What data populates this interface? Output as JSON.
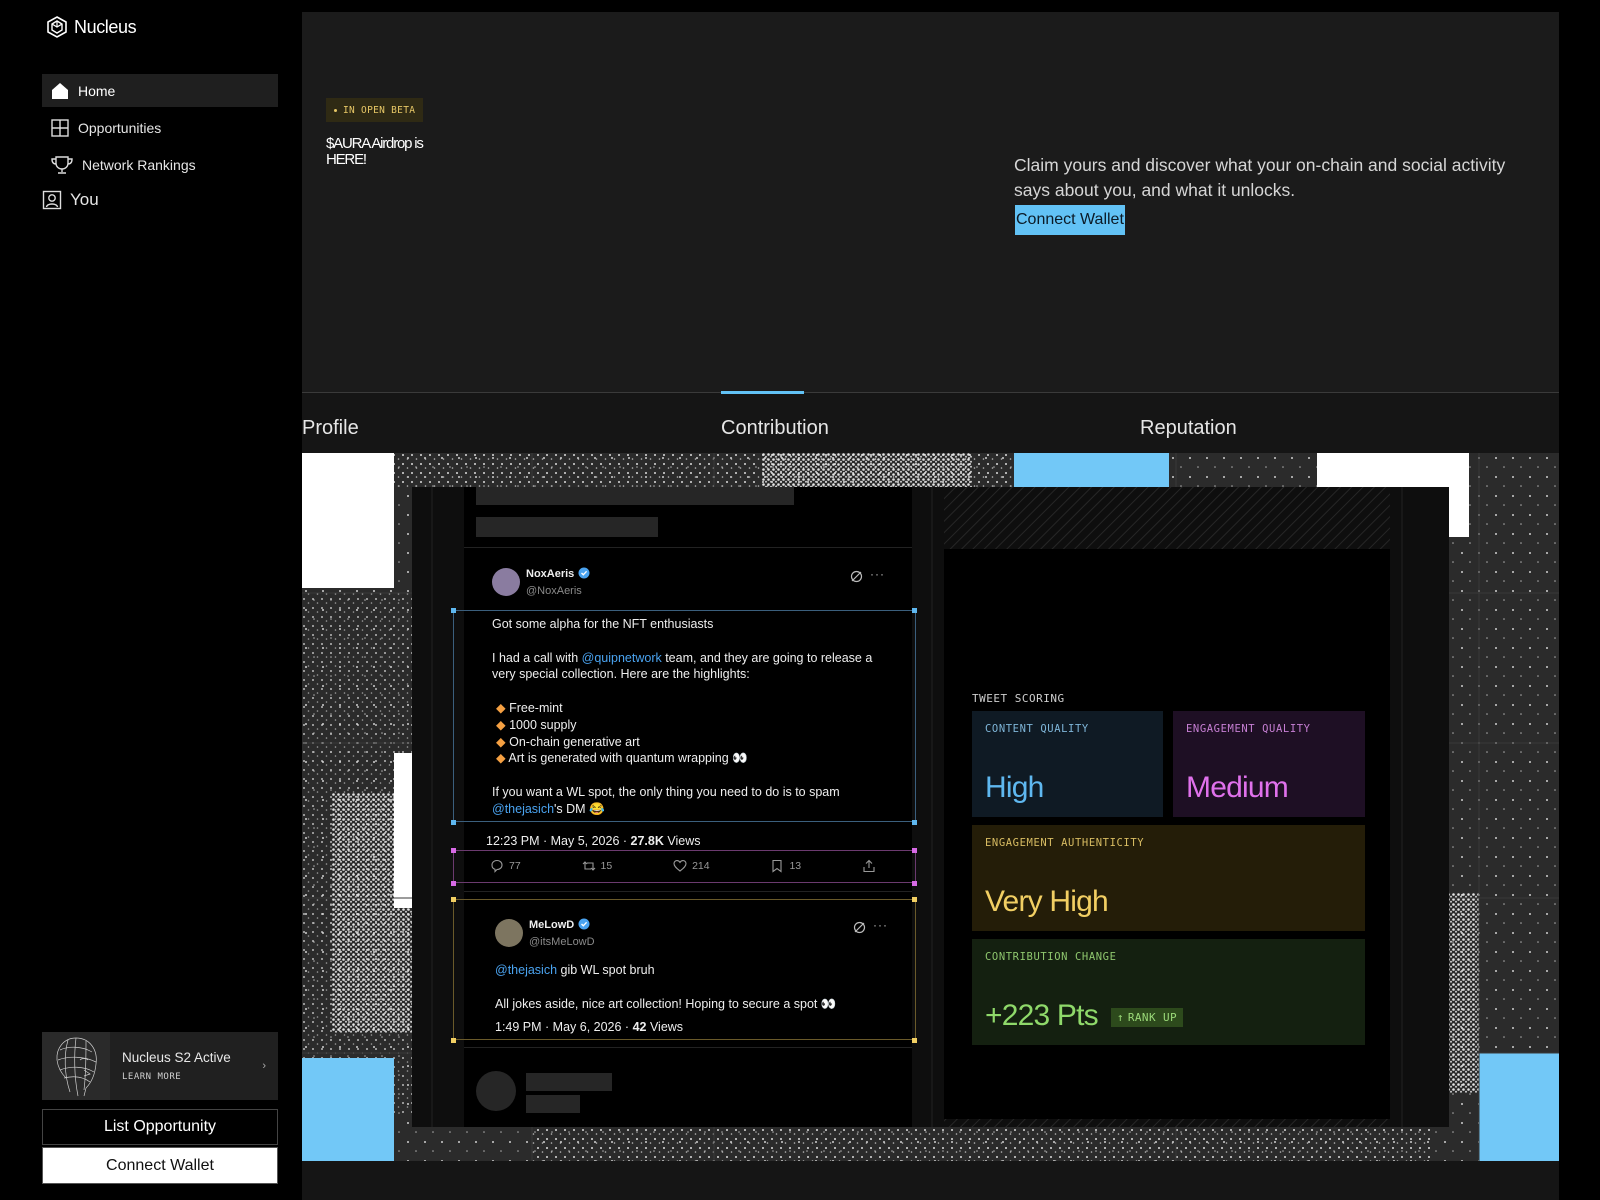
{
  "app": {
    "name": "Nucleus"
  },
  "nav": {
    "items": [
      {
        "label": "Home",
        "icon": "home-icon",
        "active": true
      },
      {
        "label": "Opportunities",
        "icon": "grid-icon",
        "active": false
      },
      {
        "label": "Network Rankings",
        "icon": "trophy-icon",
        "active": false
      }
    ],
    "you_label": "You"
  },
  "promo": {
    "title": "Nucleus S2 Active",
    "learn_more": "LEARN MORE"
  },
  "sidebar_actions": {
    "list_label": "List Opportunity",
    "connect_label": "Connect Wallet"
  },
  "hero": {
    "badge": "IN OPEN BETA",
    "title": "$AURA Airdrop is HERE!",
    "description": "Claim yours and discover what your on-chain and social activity says about you, and what it unlocks.",
    "button_label": "Connect Wallet"
  },
  "tabs": [
    {
      "label": "Profile",
      "active": false
    },
    {
      "label": "Contribution",
      "active": true
    },
    {
      "label": "Reputation",
      "active": false
    }
  ],
  "tweet1": {
    "name": "NoxAeris",
    "handle": "@NoxAeris",
    "line1": "Got some alpha for the NFT enthusiasts",
    "line2a": "I had a call with ",
    "mention1": "@quipnetwork",
    "line2b": " team, and they are going to release a very special collection. Here are the highlights:",
    "bullets": [
      "Free-mint",
      "1000 supply",
      "On-chain generative art",
      "Art is generated with quantum wrapping 👀"
    ],
    "line3": "If you want a WL spot, the only thing you need to do is to spam",
    "mention2": "@thejasich",
    "line3b": "'s DM 😂",
    "time": "12:23 PM · May 5, 2026 · ",
    "views_count": "27.8K",
    "views_label": " Views",
    "replies": "77",
    "retweets": "15",
    "likes": "214",
    "bookmarks": "13"
  },
  "tweet2": {
    "name": "MeLowD",
    "handle": "@itsMeLowD",
    "mention": "@thejasich",
    "line1b": " gib WL spot bruh",
    "line2": "All jokes aside, nice art collection! Hoping to secure a spot 👀",
    "time": "1:49 PM · May 6, 2026 · ",
    "views_count": "42",
    "views_label": " Views"
  },
  "scoring": {
    "title": "TWEET SCORING",
    "content_quality": {
      "label": "CONTENT QUALITY",
      "value": "High",
      "color": "#5fb8f0"
    },
    "engagement_quality": {
      "label": "ENGAGEMENT QUALITY",
      "value": "Medium",
      "color": "#e071ec"
    },
    "engagement_authenticity": {
      "label": "ENGAGEMENT AUTHENTICITY",
      "value": "Very High",
      "color": "#f2cf63"
    },
    "contribution_change": {
      "label": "CONTRIBUTION CHANGE",
      "value": "+223 Pts",
      "badge": "RANK UP",
      "color": "#8fd96a"
    }
  },
  "colors": {
    "accent": "#62c2f5",
    "beta": "#e7c766"
  }
}
